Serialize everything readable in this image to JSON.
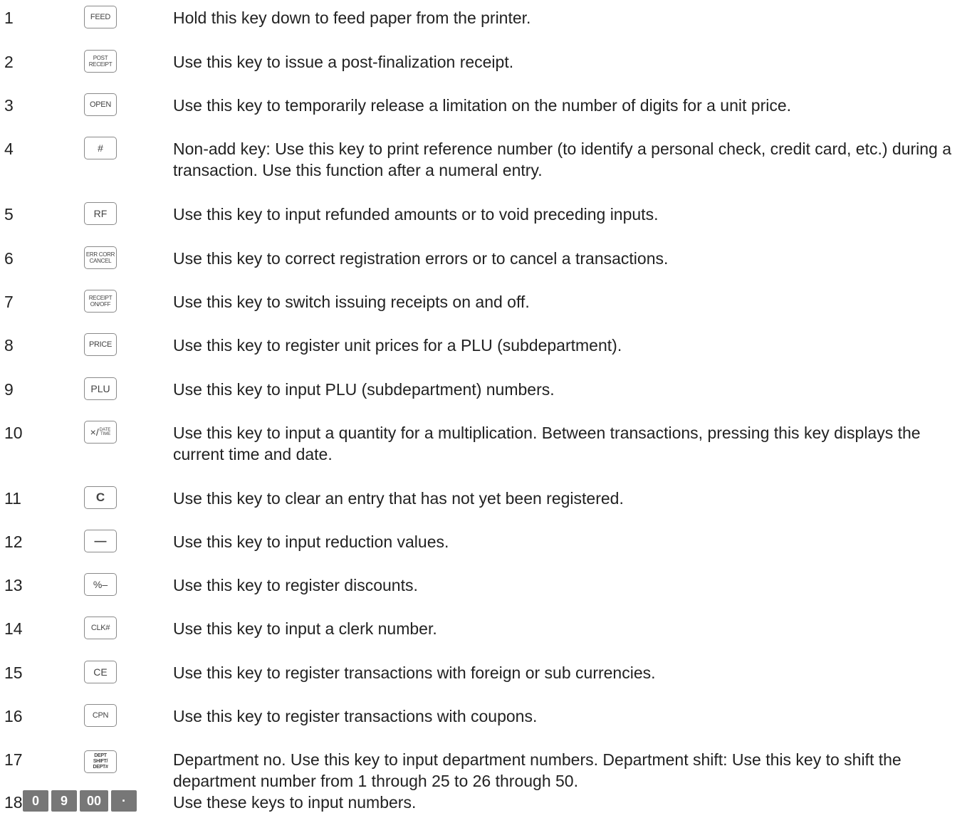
{
  "rows": [
    {
      "num": "1",
      "key": "FEED",
      "desc": "Hold this key down to feed paper from the printer."
    },
    {
      "num": "2",
      "key": [
        "POST",
        "RECEIPT"
      ],
      "desc": "Use this key to issue a post-finalization receipt."
    },
    {
      "num": "3",
      "key": "OPEN",
      "desc": "Use this key to temporarily release a limitation on the number of digits for a unit price."
    },
    {
      "num": "4",
      "key": "#",
      "desc": "Non-add key: Use this key to print reference number (to identify a personal check, credit card, etc.) during a transaction. Use this function after a numeral entry."
    },
    {
      "num": "5",
      "key": "RF",
      "desc": "Use this key to input refunded amounts or to void preceding inputs."
    },
    {
      "num": "6",
      "key": [
        "ERR CORR",
        "CANCEL"
      ],
      "desc": "Use this key to correct registration errors or to cancel a transactions."
    },
    {
      "num": "7",
      "key": [
        "RECEIPT",
        "ON/OFF"
      ],
      "desc": "Use this key to switch issuing receipts on and off."
    },
    {
      "num": "8",
      "key": "PRICE",
      "desc": "Use this key to register unit prices for a PLU (subdepartment)."
    },
    {
      "num": "9",
      "key": "PLU",
      "desc": "Use this key to input PLU (subdepartment) numbers."
    },
    {
      "num": "10",
      "key": [
        "×/",
        "DATE",
        "TIME"
      ],
      "desc": "Use this key to input a quantity for a multiplication. Between transactions, pressing this key displays the current time and date."
    },
    {
      "num": "11",
      "key": "C",
      "desc": "Use this key to clear an entry that has not yet been registered."
    },
    {
      "num": "12",
      "key": "—",
      "desc": "Use this key to input reduction values."
    },
    {
      "num": "13",
      "key": "%–",
      "desc": "Use this key to register discounts."
    },
    {
      "num": "14",
      "key": "CLK#",
      "desc": "Use this key to input a clerk number."
    },
    {
      "num": "15",
      "key": "CE",
      "desc": "Use this key to register transactions with foreign or sub currencies."
    },
    {
      "num": "16",
      "key": "CPN",
      "desc": "Use this key to register transactions with coupons."
    },
    {
      "num": "17",
      "key": [
        "DEPT",
        "SHIFT/",
        "DEPT#"
      ],
      "desc": "Department no. Use this key to input department numbers. Department shift: Use this key to shift the department number from 1 through 25 to 26 through 50."
    },
    {
      "num": "18",
      "key": [
        "0",
        "9",
        "00",
        "·"
      ],
      "desc": "Use these keys to input numbers."
    }
  ]
}
